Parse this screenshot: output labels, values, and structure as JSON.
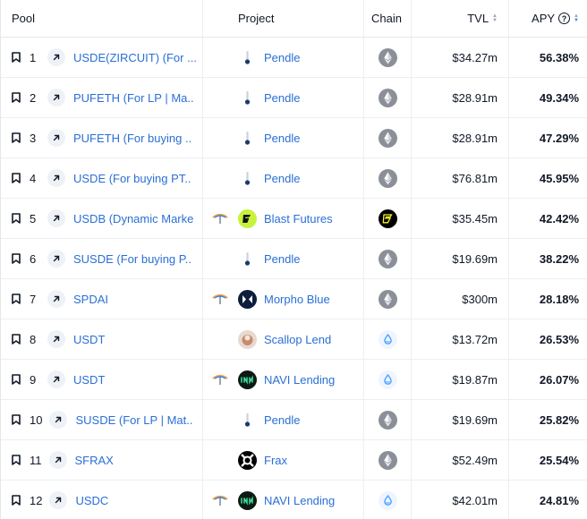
{
  "header": {
    "pool": "Pool",
    "project": "Project",
    "chain": "Chain",
    "tvl": "TVL",
    "apy": "APY",
    "apy_info": "?"
  },
  "rows": [
    {
      "rank": "1",
      "pool": "USDE(ZIRCUIT) (For ...",
      "project": "Pendle",
      "logo": "pendle",
      "chain": "ethereum",
      "tvl": "$34.27m",
      "apy": "56.38%",
      "forked": false
    },
    {
      "rank": "2",
      "pool": "PUFETH (For LP | Ma..",
      "project": "Pendle",
      "logo": "pendle",
      "chain": "ethereum",
      "tvl": "$28.91m",
      "apy": "49.34%",
      "forked": false
    },
    {
      "rank": "3",
      "pool": "PUFETH (For buying ..",
      "project": "Pendle",
      "logo": "pendle",
      "chain": "ethereum",
      "tvl": "$28.91m",
      "apy": "47.29%",
      "forked": false
    },
    {
      "rank": "4",
      "pool": "USDE (For buying PT..",
      "project": "Pendle",
      "logo": "pendle",
      "chain": "ethereum",
      "tvl": "$76.81m",
      "apy": "45.95%",
      "forked": false
    },
    {
      "rank": "5",
      "pool": "USDB (Dynamic Marke",
      "project": "Blast Futures",
      "logo": "blast",
      "chain": "blast",
      "tvl": "$35.45m",
      "apy": "42.42%",
      "forked": true
    },
    {
      "rank": "6",
      "pool": "SUSDE (For buying P..",
      "project": "Pendle",
      "logo": "pendle",
      "chain": "ethereum",
      "tvl": "$19.69m",
      "apy": "38.22%",
      "forked": false
    },
    {
      "rank": "7",
      "pool": "SPDAI",
      "project": "Morpho Blue",
      "logo": "morpho",
      "chain": "ethereum",
      "tvl": "$300m",
      "apy": "28.18%",
      "forked": true
    },
    {
      "rank": "8",
      "pool": "USDT",
      "project": "Scallop Lend",
      "logo": "scallop",
      "chain": "sui",
      "tvl": "$13.72m",
      "apy": "26.53%",
      "forked": false
    },
    {
      "rank": "9",
      "pool": "USDT",
      "project": "NAVI Lending",
      "logo": "navi",
      "chain": "sui",
      "tvl": "$19.87m",
      "apy": "26.07%",
      "forked": true
    },
    {
      "rank": "10",
      "pool": "SUSDE (For LP | Mat..",
      "project": "Pendle",
      "logo": "pendle",
      "chain": "ethereum",
      "tvl": "$19.69m",
      "apy": "25.82%",
      "forked": false
    },
    {
      "rank": "11",
      "pool": "SFRAX",
      "project": "Frax",
      "logo": "frax",
      "chain": "ethereum",
      "tvl": "$52.49m",
      "apy": "25.54%",
      "forked": false
    },
    {
      "rank": "12",
      "pool": "USDC",
      "project": "NAVI Lending",
      "logo": "navi",
      "chain": "sui",
      "tvl": "$42.01m",
      "apy": "24.81%",
      "forked": true
    }
  ]
}
